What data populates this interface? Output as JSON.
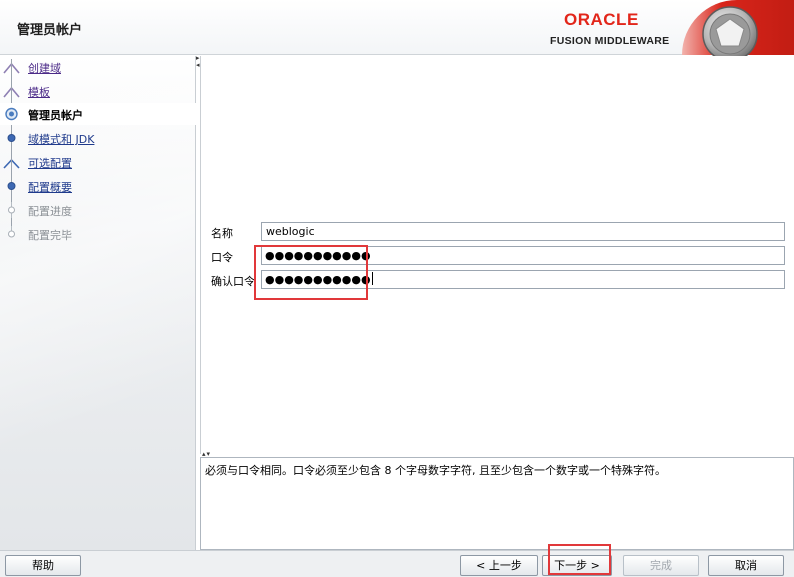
{
  "header": {
    "title": "管理员帐户",
    "logo_word": "ORACLE",
    "logo_subtitle": "FUSION MIDDLEWARE"
  },
  "nav": {
    "items": [
      {
        "label": "创建域",
        "state": "visited"
      },
      {
        "label": "模板",
        "state": "visited"
      },
      {
        "label": "管理员帐户",
        "state": "current"
      },
      {
        "label": "域模式和 JDK",
        "state": "link"
      },
      {
        "label": "可选配置",
        "state": "link"
      },
      {
        "label": "配置概要",
        "state": "link"
      },
      {
        "label": "配置进度",
        "state": "disabled"
      },
      {
        "label": "配置完毕",
        "state": "disabled"
      }
    ]
  },
  "form": {
    "name_label": "名称",
    "name_value": "weblogic",
    "password_label": "口令",
    "password_mask": "●●●●●●●●●●●",
    "confirm_label": "确认口令",
    "confirm_mask": "●●●●●●●●●●●"
  },
  "message": {
    "text": "必须与口令相同。口令必须至少包含 8 个字母数字字符, 且至少包含一个数字或一个特殊字符。"
  },
  "buttons": {
    "help": "帮助",
    "back": "< 上一步",
    "next": "下一步 >",
    "finish": "完成",
    "cancel": "取消"
  },
  "colors": {
    "oracle_red": "#e2261a",
    "annotation_red": "#e1383a",
    "link_blue": "#1f3a8c"
  }
}
